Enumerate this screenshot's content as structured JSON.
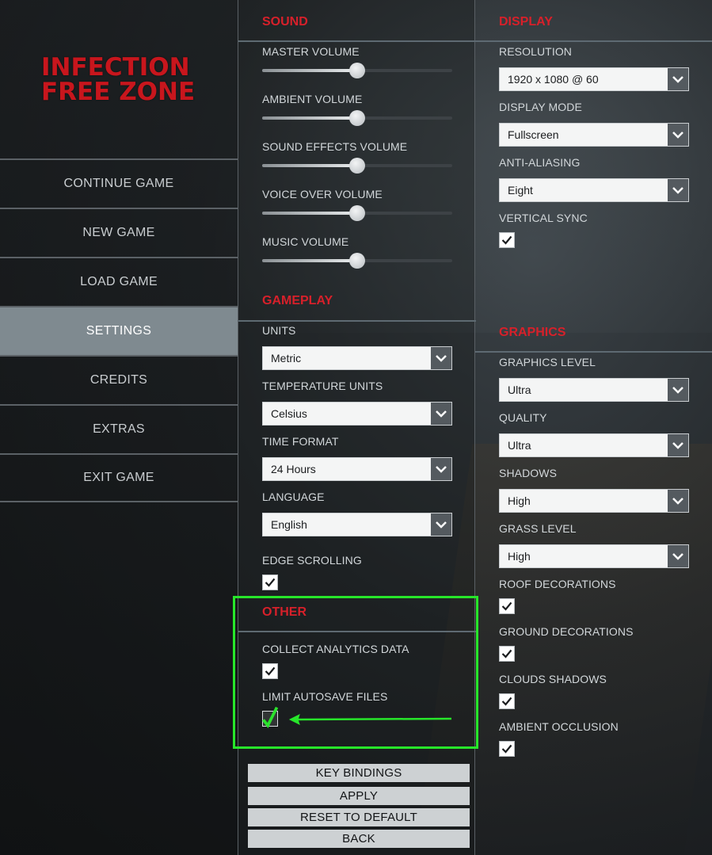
{
  "logo": {
    "line1": "INFECTION",
    "line2": "FREE ZONE"
  },
  "menu": [
    {
      "label": "CONTINUE GAME",
      "active": false
    },
    {
      "label": "NEW GAME",
      "active": false
    },
    {
      "label": "LOAD GAME",
      "active": false
    },
    {
      "label": "SETTINGS",
      "active": true
    },
    {
      "label": "CREDITS",
      "active": false
    },
    {
      "label": "EXTRAS",
      "active": false
    },
    {
      "label": "EXIT GAME",
      "active": false
    }
  ],
  "sound": {
    "title": "SOUND",
    "sliders": [
      {
        "label": "MASTER VOLUME",
        "value": 0.5
      },
      {
        "label": "AMBIENT VOLUME",
        "value": 0.5
      },
      {
        "label": "SOUND EFFECTS VOLUME",
        "value": 0.5
      },
      {
        "label": "VOICE OVER VOLUME",
        "value": 0.5
      },
      {
        "label": "MUSIC VOLUME",
        "value": 0.5
      }
    ]
  },
  "gameplay": {
    "title": "GAMEPLAY",
    "units": {
      "label": "UNITS",
      "value": "Metric"
    },
    "temperature_units": {
      "label": "TEMPERATURE UNITS",
      "value": "Celsius"
    },
    "time_format": {
      "label": "TIME FORMAT",
      "value": "24 Hours"
    },
    "language": {
      "label": "LANGUAGE",
      "value": "English"
    },
    "edge_scrolling": {
      "label": "EDGE SCROLLING",
      "checked": true
    }
  },
  "other": {
    "title": "OTHER",
    "collect_analytics": {
      "label": "COLLECT ANALYTICS DATA",
      "checked": true
    },
    "limit_autosave": {
      "label": "LIMIT AUTOSAVE FILES",
      "checked": true
    }
  },
  "buttons": {
    "key_bindings": "KEY BINDINGS",
    "apply": "APPLY",
    "reset": "RESET TO DEFAULT",
    "back": "BACK"
  },
  "display": {
    "title": "DISPLAY",
    "resolution": {
      "label": "RESOLUTION",
      "value": "1920 x 1080 @ 60"
    },
    "display_mode": {
      "label": "DISPLAY MODE",
      "value": "Fullscreen"
    },
    "anti_aliasing": {
      "label": "ANTI-ALIASING",
      "value": "Eight"
    },
    "vertical_sync": {
      "label": "VERTICAL SYNC",
      "checked": true
    }
  },
  "graphics": {
    "title": "GRAPHICS",
    "graphics_level": {
      "label": "GRAPHICS LEVEL",
      "value": "Ultra"
    },
    "quality": {
      "label": "QUALITY",
      "value": "Ultra"
    },
    "shadows": {
      "label": "SHADOWS",
      "value": "High"
    },
    "grass_level": {
      "label": "GRASS LEVEL",
      "value": "High"
    },
    "roof_decorations": {
      "label": "ROOF DECORATIONS",
      "checked": true
    },
    "ground_decorations": {
      "label": "GROUND DECORATIONS",
      "checked": true
    },
    "clouds_shadows": {
      "label": "CLOUDS SHADOWS",
      "checked": true
    },
    "ambient_occlusion": {
      "label": "AMBIENT OCCLUSION",
      "checked": true
    }
  },
  "colors": {
    "accent_red": "#d7202a",
    "highlight_green": "#27e62a",
    "active_menu": "#7f8a90"
  }
}
